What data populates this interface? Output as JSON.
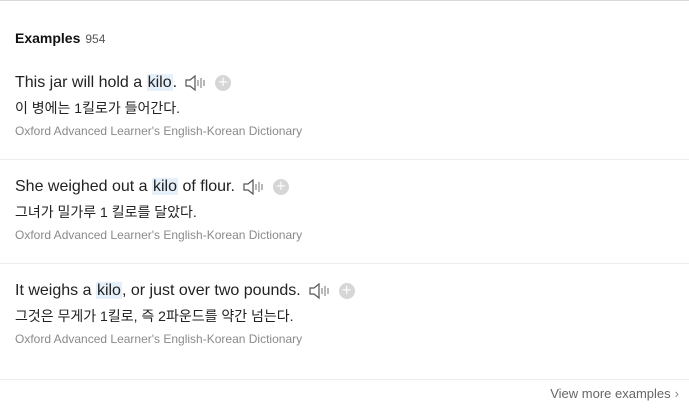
{
  "section": {
    "title": "Examples",
    "count": "954"
  },
  "examples": [
    {
      "before": "This jar will hold a ",
      "highlight": "kilo",
      "after": ".",
      "translation": "이 병에는 1킬로가 들어간다.",
      "source": "Oxford Advanced Learner's English-Korean Dictionary"
    },
    {
      "before": "She weighed out a ",
      "highlight": "kilo",
      "after": " of flour.",
      "translation": "그녀가 밀가루 1 킬로를 달았다.",
      "source": "Oxford Advanced Learner's English-Korean Dictionary"
    },
    {
      "before": "It weighs a ",
      "highlight": "kilo",
      "after": ", or just over two pounds.",
      "translation": "그것은 무게가 1킬로, 즉 2파운드를 약간 넘는다.",
      "source": "Oxford Advanced Learner's English-Korean Dictionary"
    }
  ],
  "footer": {
    "view_more": "View more examples",
    "chevron": "›"
  },
  "icons": {
    "speaker": "speaker-icon",
    "add": "plus-circle-icon"
  },
  "colors": {
    "highlight": "#e6f0fb",
    "source_text": "#8a8a8a",
    "add_icon": "#d6d6d6"
  }
}
